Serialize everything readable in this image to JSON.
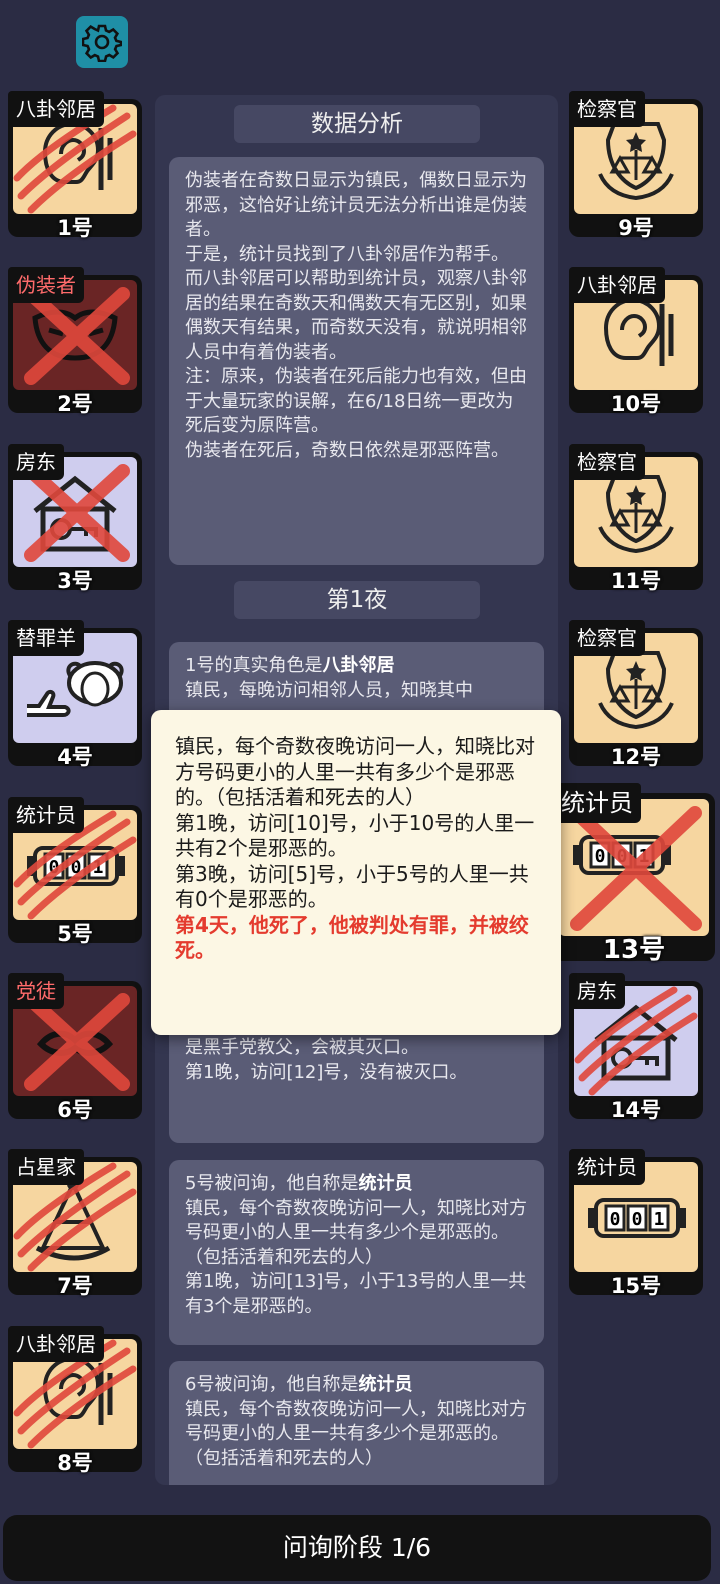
{
  "settings": {
    "icon": "gear-icon"
  },
  "analysis": {
    "title": "数据分析",
    "body": "伪装者在奇数日显示为镇民，偶数日显示为邪恶，这恰好让统计员无法分析出谁是伪装者。\n于是，统计员找到了八卦邻居作为帮手。\n而八卦邻居可以帮助到统计员，观察八卦邻居的结果在奇数天和偶数天有无区别，如果偶数天有结果，而奇数天没有，就说明相邻人员中有着伪装者。\n注：原来，伪装者在死后能力也有效，但由于大量玩家的误解，在6/18日统一更改为死后变为原阵营。\n伪装者在死后，奇数日依然是邪恶阵营。"
  },
  "night": {
    "title": "第1夜",
    "entry1": {
      "prefix": "1号的真实角色是",
      "role": "八卦邻居",
      "rest": "镇民，每晚访问相邻人员，知晓其中"
    },
    "entry4": {
      "text": "4号被问询，他自称是替罪羊\n中立，每晚访问一人（先于灌醉），若对方是黑手党教父，会被其灭口。\n第1晚，访问[12]号，没有被灭口。"
    },
    "entry5": {
      "prefix": "5号被问询，他自称是",
      "role": "统计员",
      "rest": "镇民，每个奇数夜晚访问一人，知晓比对方号码更小的人里一共有多少个是邪恶的。（包括活着和死去的人）\n第1晚，访问[13]号，小于13号的人里一共有3个是邪恶的。"
    },
    "entry6": {
      "prefix": "6号被问询，他自称是",
      "role": "统计员",
      "rest": "镇民，每个奇数夜晚访问一人，知晓比对方号码更小的人里一共有多少个是邪恶的。（包括活着和死去的人）"
    }
  },
  "popup": {
    "line1": "镇民，每个奇数夜晚访问一人，知晓比对方号码更小的人里一共有多少个是邪恶的。（包括活着和死去的人）",
    "line2": "第1晚，访问[10]号，小于10号的人里一共有2个是邪恶的。",
    "line3": "第3晚，访问[5]号，小于5号的人里一共有0个是邪恶的。",
    "line4": "第4天，他死了，他被判处有罪，并被绞死。"
  },
  "players": [
    {
      "label": "八卦邻居",
      "num": "1号",
      "icon": "ear-icon",
      "state": "clawed"
    },
    {
      "label": "伪装者",
      "num": "2号",
      "icon": "mask-icon",
      "state": "dead"
    },
    {
      "label": "房东",
      "num": "3号",
      "icon": "house-key-icon",
      "state": "crossed"
    },
    {
      "label": "替罪羊",
      "num": "4号",
      "icon": "sheep-icon",
      "state": "alive"
    },
    {
      "label": "统计员",
      "num": "5号",
      "icon": "counter-icon",
      "state": "clawed"
    },
    {
      "label": "党徒",
      "num": "6号",
      "icon": "handshake-icon",
      "state": "dead"
    },
    {
      "label": "占星家",
      "num": "7号",
      "icon": "sextant-icon",
      "state": "clawed"
    },
    {
      "label": "八卦邻居",
      "num": "8号",
      "icon": "ear-icon",
      "state": "clawed"
    },
    {
      "label": "检察官",
      "num": "9号",
      "icon": "justice-icon",
      "state": "alive"
    },
    {
      "label": "八卦邻居",
      "num": "10号",
      "icon": "ear-icon",
      "state": "alive"
    },
    {
      "label": "检察官",
      "num": "11号",
      "icon": "justice-icon",
      "state": "alive"
    },
    {
      "label": "检察官",
      "num": "12号",
      "icon": "justice-icon",
      "state": "alive"
    },
    {
      "label": "统计员",
      "num": "13号",
      "icon": "counter-icon",
      "state": "crossed"
    },
    {
      "label": "房东",
      "num": "14号",
      "icon": "house-key-icon",
      "state": "clawed"
    },
    {
      "label": "统计员",
      "num": "15号",
      "icon": "counter-icon",
      "state": "alive"
    }
  ],
  "counter_digits": "001",
  "colors": {
    "background": "#2b2c44",
    "card_town": "#f6d6a0",
    "card_neutral": "#cfcdee",
    "card_evil": "#6a2525",
    "cross_red": "#e0483c",
    "popup_alert": "#e43b2e"
  },
  "footer": {
    "phase": "问询阶段 1/6"
  }
}
